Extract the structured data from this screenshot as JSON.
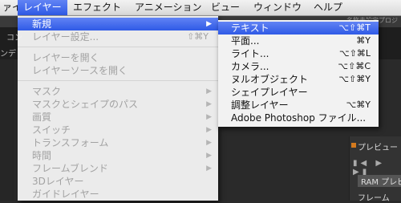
{
  "menubar": {
    "items": [
      "ァイル",
      "レイヤー",
      "エフェクト",
      "アニメーション",
      "ビュー",
      "ウィンドウ",
      "ヘルプ"
    ],
    "right_text": "名称未設定プロジ"
  },
  "background": {
    "tab_left": "コン",
    "tab_left2": "ンデ",
    "preview": "プレビュー",
    "ram": "RAM プレビ",
    "frame": "フレーム"
  },
  "layer_menu": {
    "items": [
      {
        "label": "新規",
        "shortcut": "",
        "submenu": true,
        "enabled": true,
        "active": true
      },
      {
        "label": "レイヤー設定...",
        "shortcut": "⇧⌘Y",
        "submenu": false,
        "enabled": false
      },
      {
        "label": "レイヤーを開く",
        "shortcut": "",
        "submenu": false,
        "enabled": false
      },
      {
        "label": "レイヤーソースを開く",
        "shortcut": "",
        "submenu": false,
        "enabled": false
      },
      {
        "label": "マスク",
        "shortcut": "",
        "submenu": true,
        "enabled": false
      },
      {
        "label": "マスクとシェイプのパス",
        "shortcut": "",
        "submenu": true,
        "enabled": false
      },
      {
        "label": "画質",
        "shortcut": "",
        "submenu": true,
        "enabled": false
      },
      {
        "label": "スイッチ",
        "shortcut": "",
        "submenu": true,
        "enabled": false
      },
      {
        "label": "トランスフォーム",
        "shortcut": "",
        "submenu": true,
        "enabled": false
      },
      {
        "label": "時間",
        "shortcut": "",
        "submenu": true,
        "enabled": false
      },
      {
        "label": "フレームブレンド",
        "shortcut": "",
        "submenu": true,
        "enabled": false
      },
      {
        "label": "3Dレイヤー",
        "shortcut": "",
        "submenu": false,
        "enabled": false
      },
      {
        "label": "ガイドレイヤー",
        "shortcut": "",
        "submenu": false,
        "enabled": false
      }
    ]
  },
  "new_submenu": {
    "items": [
      {
        "label": "テキスト",
        "shortcut": "⌥⇧⌘T",
        "active": true
      },
      {
        "label": "平面...",
        "shortcut": "⌘Y"
      },
      {
        "label": "ライト...",
        "shortcut": "⌥⇧⌘L"
      },
      {
        "label": "カメラ...",
        "shortcut": "⌥⇧⌘C"
      },
      {
        "label": "ヌルオブジェクト",
        "shortcut": "⌥⇧⌘Y"
      },
      {
        "label": "シェイプレイヤー",
        "shortcut": ""
      },
      {
        "label": "調整レイヤー",
        "shortcut": "⌥⌘Y"
      },
      {
        "label": "Adobe Photoshop ファイル...",
        "shortcut": ""
      }
    ]
  },
  "colors": {
    "highlight": "#3a63ea",
    "menu_bg": "#f2f2f2",
    "disabled_text": "#a2a2a2"
  }
}
